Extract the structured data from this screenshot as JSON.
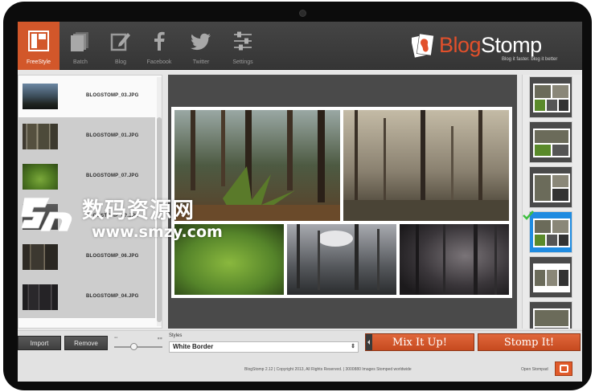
{
  "toolbar": {
    "tools": [
      {
        "label": "FreeStyle",
        "icon": "layout-icon",
        "active": true
      },
      {
        "label": "Batch",
        "icon": "stack-icon"
      },
      {
        "label": "Blog",
        "icon": "pencil-edit-icon"
      },
      {
        "label": "Facebook",
        "icon": "facebook-icon"
      },
      {
        "label": "Twitter",
        "icon": "twitter-bird-icon"
      },
      {
        "label": "Settings",
        "icon": "sliders-icon"
      }
    ],
    "accent_color": "#d2572a"
  },
  "brand": {
    "name_part1": "Blog",
    "name_part2": "Stomp",
    "tagline": "Blog it faster. blog it better"
  },
  "files": [
    {
      "name": "BLOGSTOMP_03.JPG",
      "selected": false
    },
    {
      "name": "BLOGSTOMP_01.JPG",
      "selected": true
    },
    {
      "name": "BLOGSTOMP_07.JPG",
      "selected": true
    },
    {
      "name": "BLOGSTOMP_0?.JPG",
      "selected": true
    },
    {
      "name": "BLOGSTOMP_06.JPG",
      "selected": true
    },
    {
      "name": "BLOGSTOMP_04.JPG",
      "selected": true
    }
  ],
  "bottom": {
    "import_label": "Import",
    "remove_label": "Remove",
    "styles_label": "Styles",
    "styles_value": "White Border",
    "mix_label": "Mix It Up!",
    "stomp_label": "Stomp It!",
    "copyright": "BlogStomp 2.12 | Copyright 2013, All Rights Reserved. | 3000880 Images Stomped worldwide",
    "open_stompad": "Open Stompad"
  },
  "watermark": {
    "cn_text": "数码资源网",
    "url_text": "www.smzy.com"
  }
}
